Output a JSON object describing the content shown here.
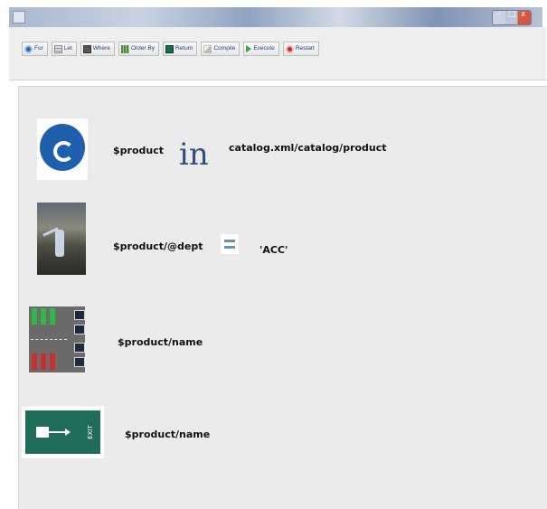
{
  "window": {
    "buttons": [
      "–",
      "□",
      "x"
    ]
  },
  "toolbar": {
    "buttons": [
      {
        "label": "For",
        "icon": "for-icon"
      },
      {
        "label": "Let",
        "icon": "let-icon"
      },
      {
        "label": "Where",
        "icon": "where-icon"
      },
      {
        "label": "Order By",
        "icon": "order-by-icon"
      },
      {
        "label": "Return",
        "icon": "return-icon"
      },
      {
        "label": "Compile",
        "icon": "compile-icon"
      },
      {
        "label": "Execute",
        "icon": "execute-icon"
      },
      {
        "label": "Restart",
        "icon": "restart-icon"
      }
    ]
  },
  "canvas": {
    "for_clause": {
      "variable": "$product",
      "operator": "in",
      "source": "catalog.xml/catalog/product"
    },
    "let_clause": {
      "variable": "$product/@dept",
      "value": "'ACC'"
    },
    "where_clause": {
      "expression": "$product/name"
    },
    "return_clause": {
      "expression": "$product/name",
      "sign_text": "EXIT"
    }
  },
  "colors": {
    "for_blue": "#1f5fae",
    "return_green": "#1f6d5a",
    "canvas_bg": "#ebebeb"
  }
}
